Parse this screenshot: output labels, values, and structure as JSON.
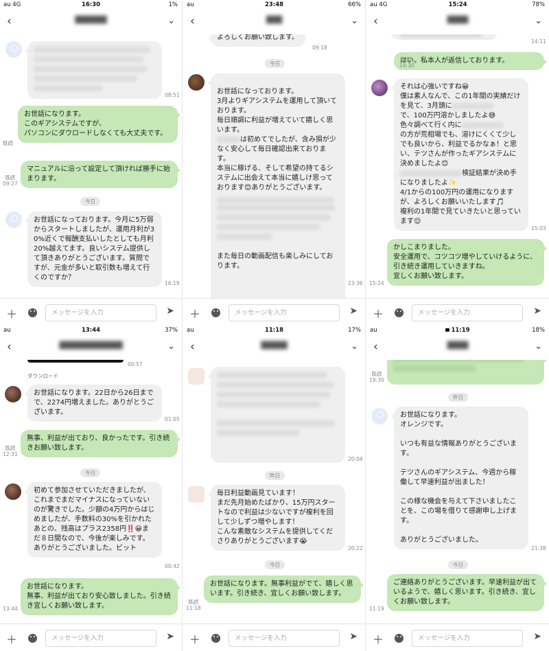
{
  "input_placeholder": "メッセージを入力",
  "panels": [
    {
      "status": {
        "left": "au 4G",
        "time": "16:30",
        "right": "1%"
      },
      "title": "",
      "msgs": {
        "m1_time": "08:51",
        "m2": "お世話になります。\nこのギアシステムですが、              \nパソコンにダウロードしなくても大丈夫です。",
        "m2_read": "既読",
        "m3": "マニュアルに沿って設定して頂ければ勝手に始まります。",
        "m3_time": "既読\n09:27",
        "date": "今日",
        "m4": "お世話になっております。今月に5万弱からスタートしましたが、運用月利が30%近くで報酬支払いしたとしても月利20%越えてます。良いシステム提供して頂きありがとうございます。質問ですが、元金が多いと取引数も増えて行くのですか？",
        "m4_time": "16:19"
      }
    },
    {
      "status": {
        "left": "au",
        "time": "23:48",
        "right": "66%"
      },
      "title": "",
      "msgs": {
        "m0": "よろしくお願い致します。",
        "m0_time": "09:18",
        "date": "今日",
        "m1a": "お世話になっております。\n3月よりギアシステムを運用して頂いております。\n毎日順調に利益が増えていて嬉しく思います。",
        "m1b": "は初めてでしたが、含み損が少なく安心して毎日確認出来ております。\n本当に稼げる、そして希望の持てるシステムに出会えて本当に嬉しけ思っております😊ありがとうございます。",
        "m1c": "また毎日の動画配信も楽しみにしております。",
        "m1_time": "23:36"
      }
    },
    {
      "status": {
        "left": "au 4G",
        "time": "15:24",
        "right": "78%"
      },
      "title": "",
      "msgs": {
        "m0_time": "14:11",
        "m1": "はい。私本人が返信しております。",
        "m1_time": "既読\n14:30",
        "m2a": "それは心強いですね😀\n僕は素人なんで、この1年間の実績だけを見て、3月頭に",
        "m2b": "で、100万円溶かしましたよ😅\n色々調べて行く内に",
        "m2c": "の方が荒相場でも、溶けにくくて少しでも良いから、利益でるかなぁ！と思い、テツさんが作ったギアシステムに決めましたよ😊",
        "m2d": "検証結果が決め手になりましたよ✨\n4/1からの100万円の運用になりますが、よろしくお願いいたします🎵\n複利の1年間で見ていきたいと思っています😌",
        "m2_time": "15:03",
        "m3": "かしこまりました。\n安全運用で、コツコツ増やしていけるように、引き続き運用していきますね。\n宜しくお願い致します。",
        "m3_time": "15:24"
      }
    },
    {
      "status": {
        "left": "au",
        "time": "13:44",
        "right": "37%"
      },
      "title": "",
      "msgs": {
        "m0_time": "00:57",
        "download": "ダウンロード",
        "m1": "お世話になります。22日から26日までで、2274円増えました。ありがとうございます。",
        "m1_time": "01:05",
        "m2": "無事、利益が出ており、良かったです。引き続きお願い致します。",
        "m2_time": "既読\n12:31",
        "date": "今日",
        "m3": "初めて参加させていただきましたが、これまでまだマイナスになっていないのが驚きでした。少額の4万円からはじめましたが、手数料の30%を引かれたあとの、残高はプラス2358円‼️😀まだ８日間なので、今後が楽しみです。ありがとうございました。ビット",
        "m3_time": "00:42",
        "m4": "お世話になります。\n無事、利益が出ており安心致しました。引き続き宜しくお願い致します。",
        "m4_time": "13:44"
      }
    },
    {
      "status": {
        "left": "au",
        "time": "11:18",
        "right": "17%"
      },
      "title": "",
      "msgs": {
        "m1_time": "20:04",
        "date": "昨日",
        "m2": "毎日利益動画見ています！\nまだ先月始めたばかり、15万円スタートなので利益は少ないですが複利を回して少しずつ増やします！\nこんな素敵なシステムを提供してくださりありがとうございます😭",
        "m2_time": "20:22",
        "date2": "今日",
        "m3": "お世話になります。無事利益がでて、嬉しく思います。引き続き、宜しくお願い致します。",
        "m3_time": "既読\n11:18"
      }
    },
    {
      "status": {
        "left": "au",
        "time": "11:19",
        "right": "18%"
      },
      "title": "",
      "msgs": {
        "m0_time": "既読\n19:30",
        "date": "昨日",
        "m1": "お世話になります。\nオレンジです。\n\nいつも有益な情報ありがとうございます。\n\nテツさんのギアシステム、今週から稼働して早速利益が出ました！\n\nこの様な機会を与えて下さいましたことを、この場を借りて感謝申し上げます。\n\nありがとうございました。",
        "m1_time": "21:38",
        "date2": "今日",
        "m2": "ご連絡ありがとうございます。早速利益が出ているようで、嬉しく思います。引き続き、宜しくお願い致します。",
        "m2_time": "11:19"
      }
    }
  ]
}
